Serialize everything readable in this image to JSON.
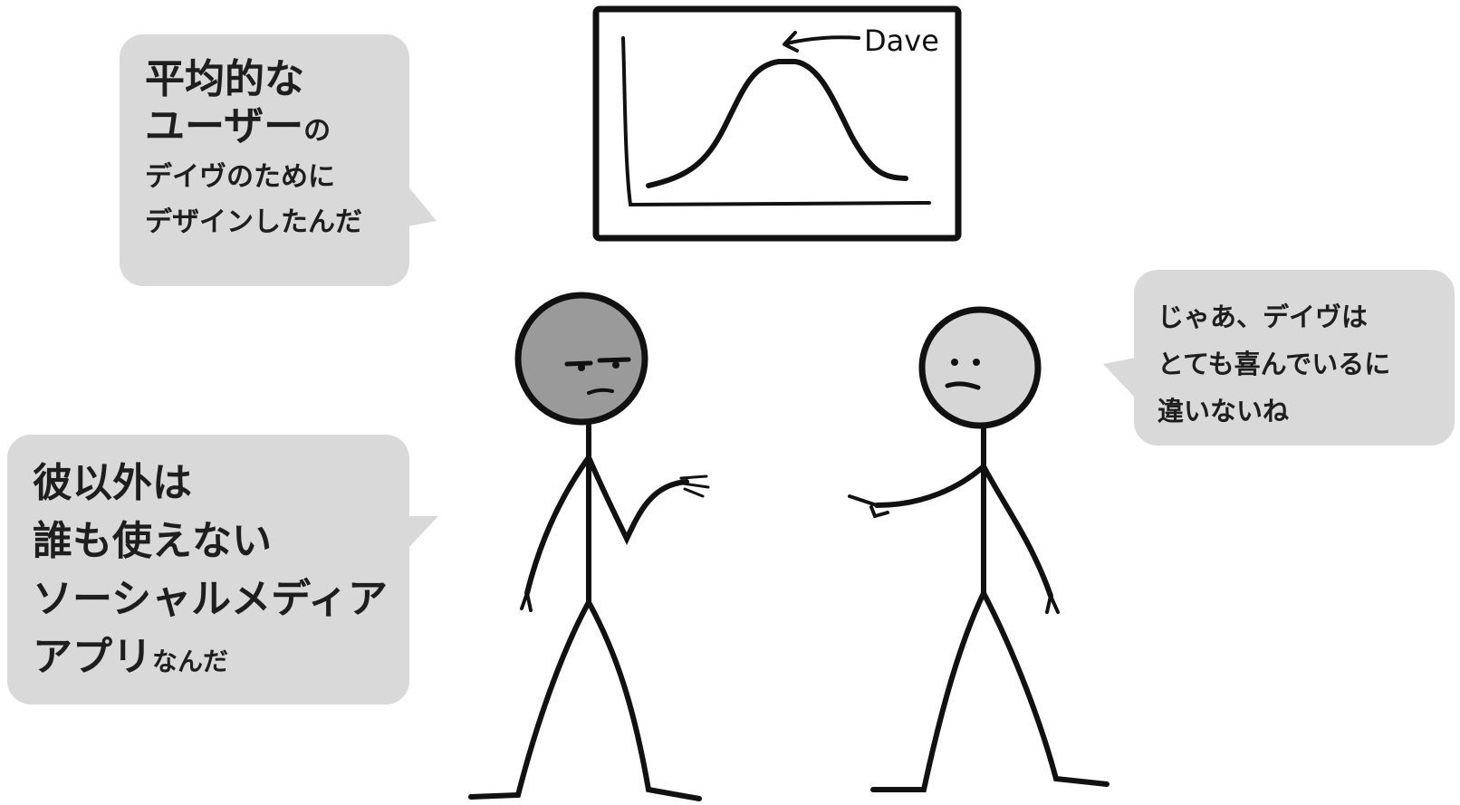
{
  "bubble_top_left": {
    "line1": "平均的な",
    "line2_bold": "ユーザー",
    "line2_small": "の",
    "line3": "デイヴのために",
    "line4": "デザインしたんだ"
  },
  "bubble_bottom_left": {
    "line1": "彼以外は",
    "line2": "誰も使えない",
    "line3": "ソーシャルメディア",
    "line4_bold": "アプリ",
    "line4_small": "なんだ"
  },
  "bubble_right": {
    "line1": "じゃあ、デイヴは",
    "line2": "とても喜んでいるに",
    "line3": "違いないね"
  },
  "chart": {
    "annotation": "Dave"
  },
  "colors": {
    "bubble": "#d9d9d9",
    "ink": "#111111",
    "face_dark": "#9a9a9a",
    "face_light": "#d6d6d6"
  }
}
